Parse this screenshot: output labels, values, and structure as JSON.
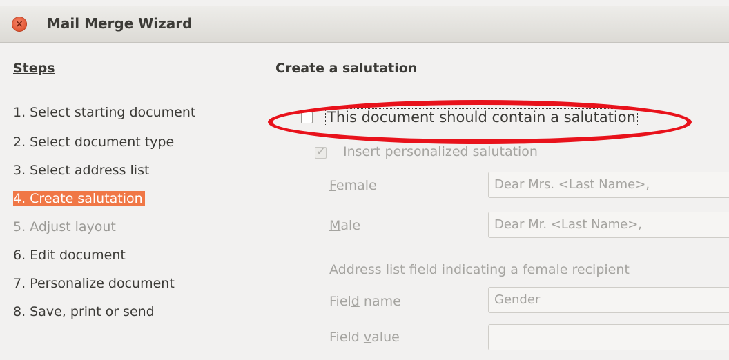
{
  "window": {
    "title": "Mail Merge Wizard",
    "close_glyph": "×"
  },
  "steps": {
    "heading": "Steps",
    "items": [
      {
        "label": "1. Select starting document"
      },
      {
        "label": "2. Select document type"
      },
      {
        "label": "3. Select address list"
      },
      {
        "label": "4. Create salutation",
        "state": "active"
      },
      {
        "label": "5. Adjust layout",
        "state": "disabled"
      },
      {
        "label": "6. Edit document"
      },
      {
        "label": "7. Personalize document"
      },
      {
        "label": "8. Save, print or send"
      }
    ]
  },
  "main": {
    "title": "Create a salutation",
    "contain_salutation": {
      "label": "This document should contain a salutation",
      "checked": false
    },
    "personalized": {
      "label": "Insert personalized salutation",
      "checked": true,
      "enabled": false
    },
    "female": {
      "label_accel": "F",
      "label_rest": "emale",
      "value": "Dear Mrs. <Last Name>,"
    },
    "male": {
      "label_accel": "M",
      "label_rest": "ale",
      "value": "Dear Mr. <Last Name>,"
    },
    "address_field_heading": "Address list field indicating a female recipient",
    "field_name": {
      "label_pre": "Fiel",
      "label_accel": "d",
      "label_rest": " name",
      "value": "Gender"
    },
    "field_value": {
      "label_pre": "Field ",
      "label_accel": "v",
      "label_rest": "alue",
      "value": ""
    }
  },
  "colors": {
    "active_step": "#f07746",
    "annotation": "#e8121b",
    "background": "#f2f1f0"
  },
  "icons": {
    "close": "close-icon",
    "check": "checkmark-icon"
  }
}
